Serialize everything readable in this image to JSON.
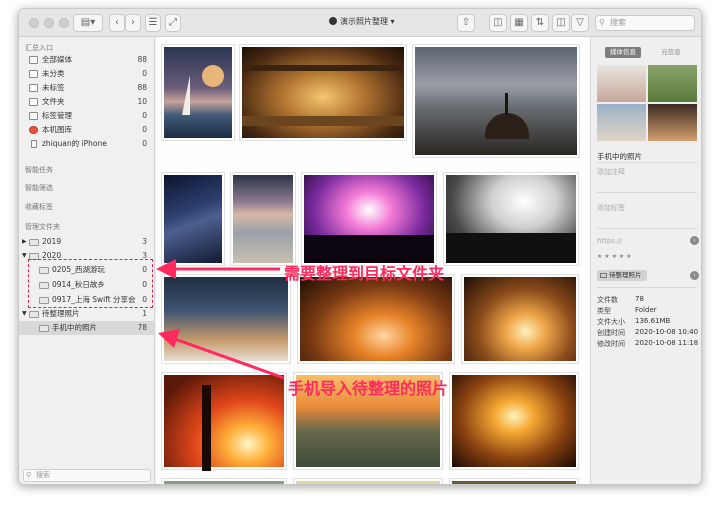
{
  "window": {
    "title": "演示照片整理"
  },
  "search": {
    "placeholder": "搜索"
  },
  "sidebar": {
    "summary_header": "汇总入口",
    "summary": [
      {
        "label": "全部媒体",
        "count": "88"
      },
      {
        "label": "未分类",
        "count": "0"
      },
      {
        "label": "未标签",
        "count": "88"
      },
      {
        "label": "文件夹",
        "count": "10"
      },
      {
        "label": "标签管理",
        "count": "0"
      },
      {
        "label": "本机图库",
        "count": "0"
      },
      {
        "label": "zhiquan的 iPhone",
        "count": "0"
      }
    ],
    "smart_tasks": "智能任务",
    "smart_filters": "智能筛选",
    "favorite_tags": "收藏标签",
    "folders_header": "管理文件夹",
    "folders": [
      {
        "label": "2019",
        "count": "3"
      },
      {
        "label": "2020",
        "count": "3"
      },
      {
        "label": "0205_西湖游玩",
        "count": "0"
      },
      {
        "label": "0914_秋日故乡",
        "count": "0"
      },
      {
        "label": "0917_上海 Swift 分享会",
        "count": "0"
      },
      {
        "label": "待整理照片",
        "count": "1"
      },
      {
        "label": "手机中的照片",
        "count": "78"
      }
    ],
    "bottom_search": "搜索"
  },
  "right_panel": {
    "tab_active": "媒体信息",
    "tab_other": "元信息",
    "album_name": "手机中的照片",
    "add_note": "添加注释",
    "add_tag": "添加标签",
    "url": "https://",
    "stars": "★ ★ ★ ★ ★",
    "folder_chip": "待整理照片",
    "meta": [
      {
        "k": "文件数",
        "v": "78"
      },
      {
        "k": "类型",
        "v": "Folder"
      },
      {
        "k": "文件大小",
        "v": "136.61MB"
      },
      {
        "k": "创建时间",
        "v": "2020-10-08 10:40"
      },
      {
        "k": "修改时间",
        "v": "2020-10-08 11:18"
      }
    ]
  },
  "annotations": {
    "a1": "需要整理到目标文件夹",
    "a2": "手机导入待整理的照片"
  },
  "colors": {
    "accent": "#ff2a5e"
  }
}
